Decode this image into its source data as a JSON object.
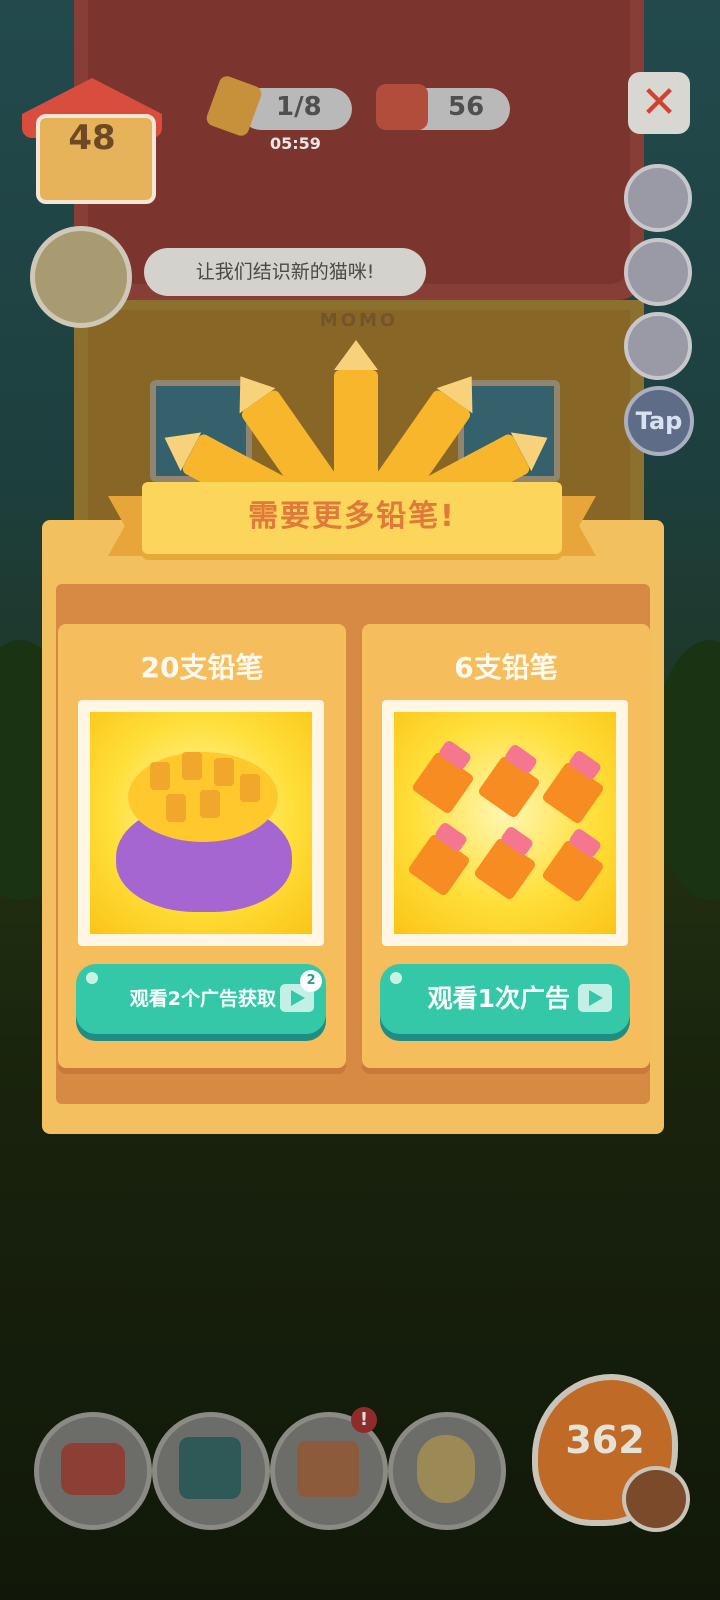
{
  "hud": {
    "home_level": "48",
    "pencil_count": "1/8",
    "timer": "05:59",
    "can_count": "56",
    "coins": "362",
    "tap_label": "Tap",
    "close_symbol": "✕",
    "speech": "让我们结识新的猫咪!",
    "sign": "MOMO"
  },
  "popup": {
    "title": "需要更多铅笔!",
    "offers": [
      {
        "title": "20支铅笔",
        "button_label": "观看2个广告获取",
        "badge": "2"
      },
      {
        "title": "6支铅笔",
        "button_label": "观看1次广告"
      }
    ]
  },
  "colors": {
    "popup_bg": "#f2c05e",
    "banner": "#fbd65a",
    "ad_button": "#35c8a8",
    "title_text": "#e0793a"
  }
}
